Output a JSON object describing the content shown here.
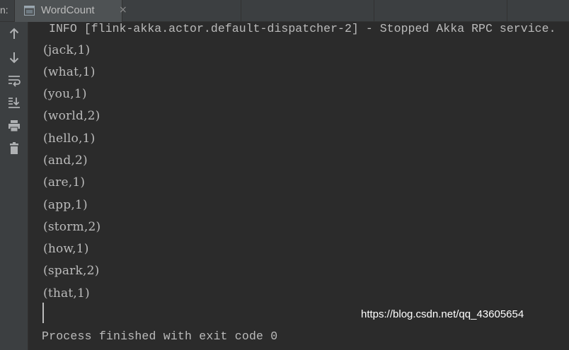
{
  "header": {
    "run_label": "n:",
    "tab_title": "WordCount",
    "tab_close": "×"
  },
  "toolbar": {
    "items": [
      {
        "name": "up-arrow-icon"
      },
      {
        "name": "down-arrow-icon"
      },
      {
        "name": "soft-wrap-icon"
      },
      {
        "name": "scroll-to-end-icon"
      },
      {
        "name": "print-icon"
      },
      {
        "name": "trash-icon"
      }
    ]
  },
  "console": {
    "info_line": "INFO [flink-akka.actor.default-dispatcher-2] - Stopped Akka RPC service.",
    "output": [
      "(jack,1)",
      "(what,1)",
      "(you,1)",
      "(world,2)",
      "(hello,1)",
      "(and,2)",
      "(are,1)",
      "(app,1)",
      "(storm,2)",
      "(how,1)",
      "(spark,2)",
      "(that,1)"
    ],
    "exit_message": "Process finished with exit code 0"
  },
  "watermark": "https://blog.csdn.net/qq_43605654",
  "colors": {
    "background": "#2b2b2b",
    "panel": "#3c3f41",
    "text": "#bbbbbb"
  }
}
